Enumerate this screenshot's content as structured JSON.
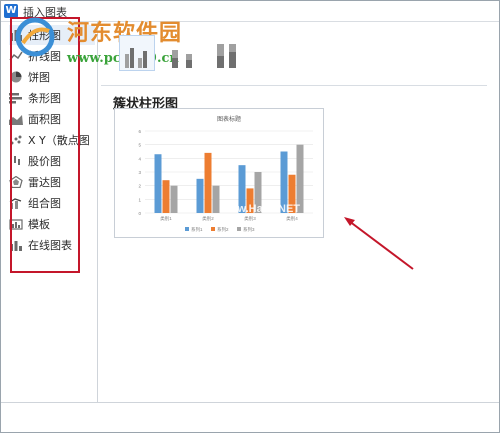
{
  "window": {
    "title": "插入图表",
    "app_icon": "W"
  },
  "sidebar": {
    "items": [
      {
        "label": "柱形图",
        "icon": "column-chart-icon",
        "active": true
      },
      {
        "label": "折线图",
        "icon": "line-chart-icon"
      },
      {
        "label": "饼图",
        "icon": "pie-chart-icon"
      },
      {
        "label": "条形图",
        "icon": "bar-chart-icon"
      },
      {
        "label": "面积图",
        "icon": "area-chart-icon"
      },
      {
        "label": "X Y（散点图",
        "icon": "scatter-chart-icon"
      },
      {
        "label": "股价图",
        "icon": "stock-chart-icon"
      },
      {
        "label": "雷达图",
        "icon": "radar-chart-icon"
      },
      {
        "label": "组合图",
        "icon": "combo-chart-icon"
      },
      {
        "label": "模板",
        "icon": "template-icon"
      },
      {
        "label": "在线图表",
        "icon": "online-chart-icon"
      }
    ]
  },
  "watermark": {
    "main": "河东软件园",
    "url": "www.pc0359.cn"
  },
  "subtypes": [
    {
      "name": "clustered-column",
      "selected": true
    },
    {
      "name": "stacked-column",
      "selected": false
    },
    {
      "name": "percent-stacked-column",
      "selected": false
    }
  ],
  "section": {
    "title": "簇状柱形图"
  },
  "preview_overlay_text": "www.Hack.NET",
  "chart_data": {
    "type": "bar",
    "title": "图表标题",
    "categories": [
      "类别1",
      "类别2",
      "类别3",
      "类别4"
    ],
    "series": [
      {
        "name": "系列1",
        "values": [
          4.3,
          2.5,
          3.5,
          4.5
        ],
        "color": "#5b9bd5"
      },
      {
        "name": "系列2",
        "values": [
          2.4,
          4.4,
          1.8,
          2.8
        ],
        "color": "#ed7d31"
      },
      {
        "name": "系列3",
        "values": [
          2,
          2,
          3,
          5
        ],
        "color": "#a5a5a5"
      }
    ],
    "yticks": [
      "0",
      "1",
      "2",
      "3",
      "4",
      "5",
      "6"
    ],
    "ylim": [
      0,
      6
    ],
    "grid": true,
    "legend": "bottom"
  },
  "colors": {
    "annotation_red": "#c4162a",
    "accent_blue": "#1f6fd1"
  }
}
